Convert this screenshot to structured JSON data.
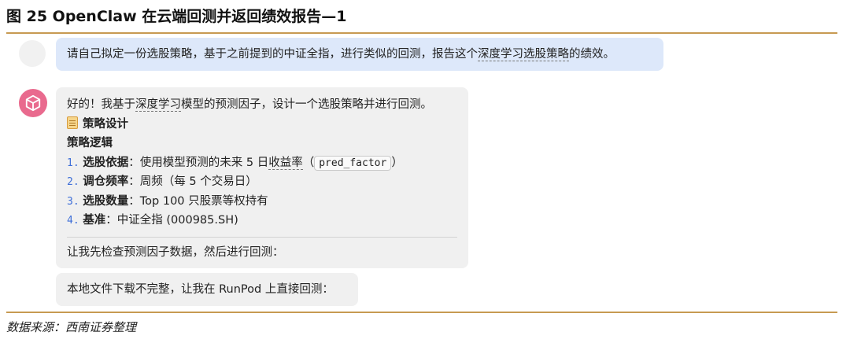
{
  "figure": {
    "title": "图 25   OpenClaw 在云端回测并返回绩效报告—1",
    "source": "数据来源：西南证券整理"
  },
  "user_message": {
    "pre": "请自己拟定一份选股策略，基于之前提到的中证全指，进行类似的回测，报告这个",
    "highlight": "深度学习选股策略",
    "post": "的绩效。"
  },
  "bot_message": {
    "intro_pre": "好的！我基于",
    "intro_highlight": "深度学习",
    "intro_post": "模型的预测因子，设计一个选股策略并进行回测。",
    "section_heading": "策略设计",
    "section_icon": "memo-icon",
    "logic_heading": "策略逻辑",
    "items": [
      {
        "num": "1.",
        "label": "选股依据",
        "text_pre": "：使用模型预测的未来 5 日",
        "text_highlight": "收益率",
        "text_post": "（",
        "code": "pred_factor",
        "text_end": "）"
      },
      {
        "num": "2.",
        "label": "调仓频率",
        "text": "：周频（每 5 个交易日）"
      },
      {
        "num": "3.",
        "label": "选股数量",
        "text": "：Top 100 只股票等权持有"
      },
      {
        "num": "4.",
        "label": "基准",
        "text": "：中证全指 (000985.SH)"
      }
    ],
    "closing": "让我先检查预测因子数据，然后进行回测："
  },
  "bot_message_2": {
    "text": "本地文件下载不完整，让我在 RunPod 上直接回测："
  },
  "colors": {
    "rule": "#c79a52",
    "user_bubble": "#dde8fa",
    "bot_bubble": "#f0f0f0",
    "bot_avatar": "#e96a8e",
    "list_number": "#3f6fd8"
  }
}
